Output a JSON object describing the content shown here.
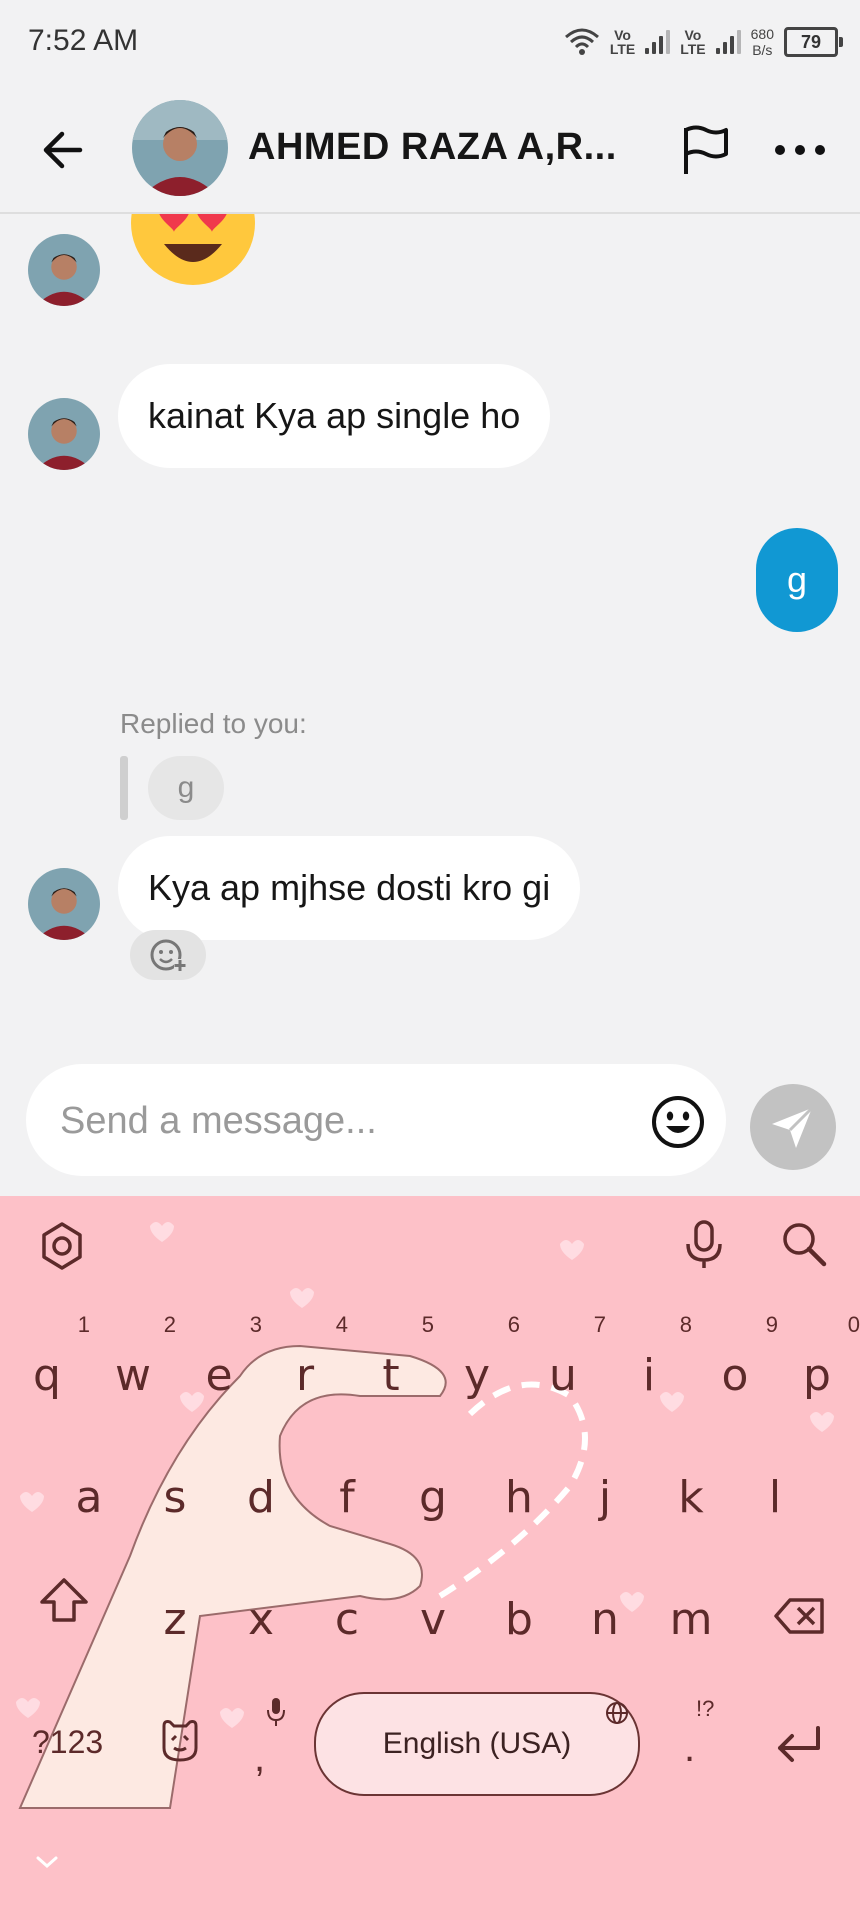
{
  "status_bar": {
    "time": "7:52 AM",
    "volte1": "Vo\nLTE",
    "volte2": "Vo\nLTE",
    "net_speed_value": "680",
    "net_speed_unit": "B/s",
    "battery": "79"
  },
  "header": {
    "contact_name": "AHMED RAZA A,R..."
  },
  "messages": [
    {
      "from": "them",
      "type": "emoji",
      "text": "😍"
    },
    {
      "from": "them",
      "type": "text",
      "text": "kainat Kya ap single ho"
    },
    {
      "from": "me",
      "type": "text",
      "text": "g"
    },
    {
      "from": "them",
      "type": "reply",
      "replied_label": "Replied to you:",
      "quoted": "g",
      "text": "Kya ap mjhse dosti kro gi"
    }
  ],
  "composer": {
    "placeholder": "Send a message..."
  },
  "keyboard": {
    "row1": [
      {
        "key": "q",
        "hint": "1"
      },
      {
        "key": "w",
        "hint": "2"
      },
      {
        "key": "e",
        "hint": "3"
      },
      {
        "key": "r",
        "hint": "4"
      },
      {
        "key": "t",
        "hint": "5"
      },
      {
        "key": "y",
        "hint": "6"
      },
      {
        "key": "u",
        "hint": "7"
      },
      {
        "key": "i",
        "hint": "8"
      },
      {
        "key": "o",
        "hint": "9"
      },
      {
        "key": "p",
        "hint": "0"
      }
    ],
    "row2": [
      "a",
      "s",
      "d",
      "f",
      "g",
      "h",
      "j",
      "k",
      "l"
    ],
    "row3": [
      "z",
      "x",
      "c",
      "v",
      "b",
      "n",
      "m"
    ],
    "symbols_key": "?123",
    "comma_key": ",",
    "space_label": "English (USA)",
    "period_key": ".",
    "period_hint": "!?",
    "colors": {
      "background": "#fdc1c8",
      "key_text": "#5c2a2a"
    }
  },
  "colors": {
    "outgoing_bubble": "#1198d3",
    "incoming_bubble": "#ffffff",
    "app_background": "#f2f2f3"
  }
}
